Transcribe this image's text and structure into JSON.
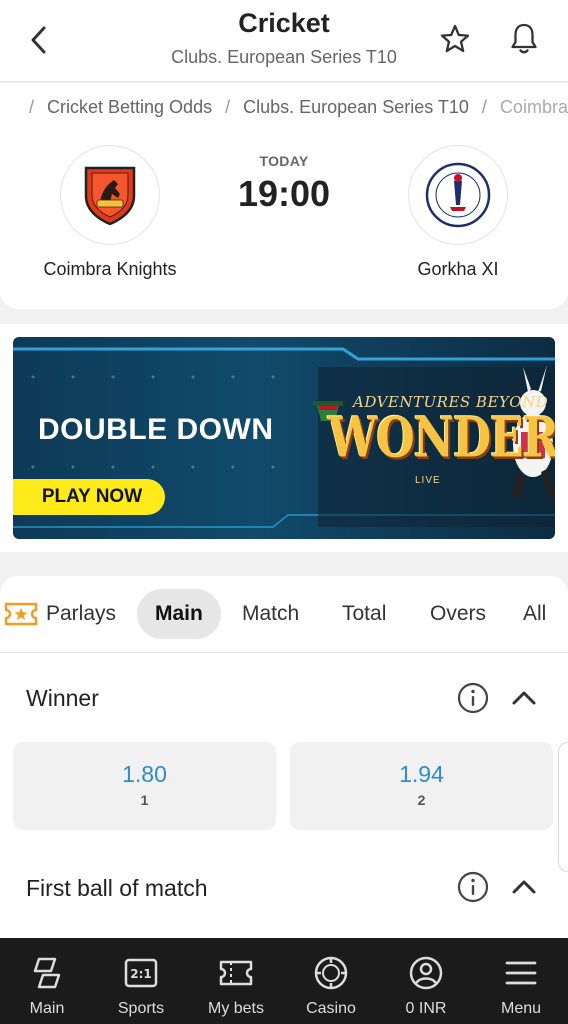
{
  "header": {
    "title": "Cricket",
    "subtitle": "Clubs. European Series T10",
    "back_icon": "chevron-left-icon",
    "favorite_icon": "star-icon",
    "notification_icon": "bell-icon"
  },
  "breadcrumb": {
    "home_icon": "home-icon",
    "items": [
      "Cricket Betting Odds",
      "Clubs. European Series T10",
      "Coimbra Knights - Gorkha XI"
    ],
    "separator": "/"
  },
  "match": {
    "home_team": "Coimbra Knights",
    "away_team": "Gorkha XI",
    "day_label": "TODAY",
    "time": "19:00"
  },
  "banner": {
    "headline": "DOUBLE DOWN",
    "cta": "PLAY NOW",
    "game_tagline": "ADVENTURES BEYOND",
    "game_title": "WONDERLAND",
    "game_subtitle": "LIVE"
  },
  "tabs": {
    "items": [
      "Parlays",
      "Main",
      "Match",
      "Total",
      "Overs",
      "All"
    ],
    "active": "Main",
    "parlays_icon": "ticket-star-icon"
  },
  "markets": {
    "winner": {
      "title": "Winner",
      "odds": [
        {
          "value": "1.80",
          "label": "1"
        },
        {
          "value": "1.94",
          "label": "2"
        }
      ]
    },
    "first_ball": {
      "title": "First ball of match"
    }
  },
  "bottom_nav": {
    "items": [
      {
        "label": "Main",
        "icon": "main-icon"
      },
      {
        "label": "Sports",
        "icon": "scoreboard-icon"
      },
      {
        "label": "My bets",
        "icon": "ticket-icon"
      },
      {
        "label": "Casino",
        "icon": "casino-chip-icon"
      },
      {
        "label": "0 INR",
        "icon": "account-icon"
      },
      {
        "label": "Menu",
        "icon": "hamburger-icon"
      }
    ]
  },
  "colors": {
    "odds_value": "#2e8ccb",
    "banner_cta": "#ffeb1a",
    "nav_background": "#1b1b1b",
    "parlays_accent": "#f39c1f"
  }
}
